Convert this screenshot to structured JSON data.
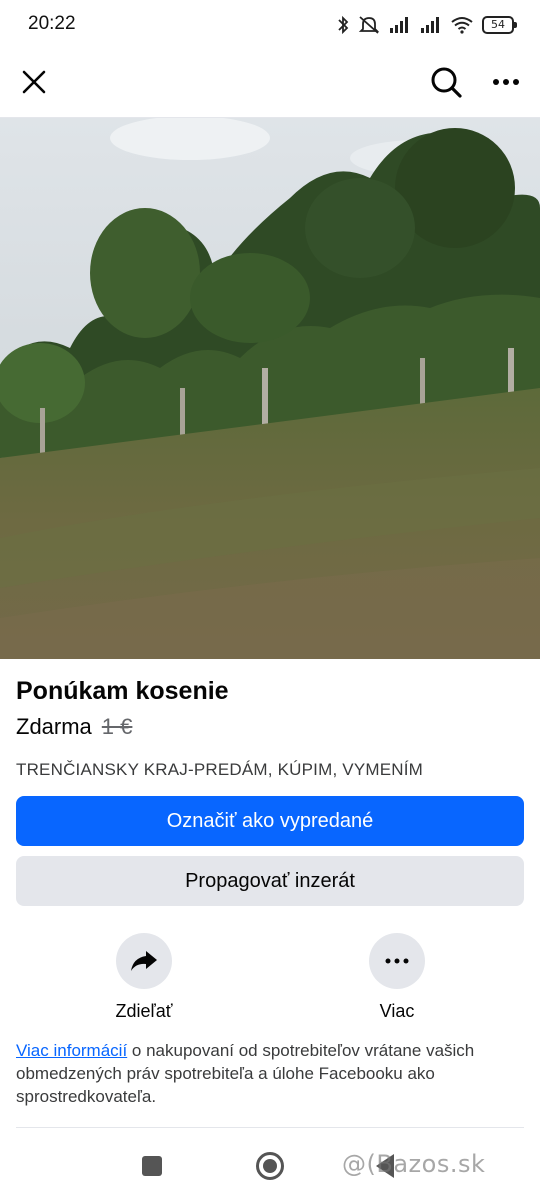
{
  "status_bar": {
    "time": "20:22",
    "battery": "54",
    "icons": [
      "bluetooth-icon",
      "mute-icon",
      "signal-icon",
      "signal-icon",
      "wifi-icon",
      "battery-icon"
    ]
  },
  "top_bar": {
    "icons": [
      "close-icon",
      "search-icon",
      "more-icon"
    ]
  },
  "listing": {
    "title": "Ponúkam kosenie",
    "price": "Zdarma",
    "old_price": "1 €",
    "category": "TRENČIANSKY KRAJ-PREDÁM, KÚPIM, VYMENÍM"
  },
  "buttons": {
    "primary": "Označiť ako vypredané",
    "secondary": "Propagovať inzerát"
  },
  "actions": {
    "share": "Zdieľať",
    "more": "Viac"
  },
  "info": {
    "link": "Viac informácií",
    "text": " o nakupovaní od spotrebiteľov vrátane vašich obmedzených práv spotrebiteľa a úlohe Facebooku ako sprostredkovateľa."
  },
  "watermark": "@(Bazos.sk",
  "colors": {
    "accent": "#0866ff",
    "secondary_bg": "#e4e6eb",
    "text": "#050505"
  }
}
